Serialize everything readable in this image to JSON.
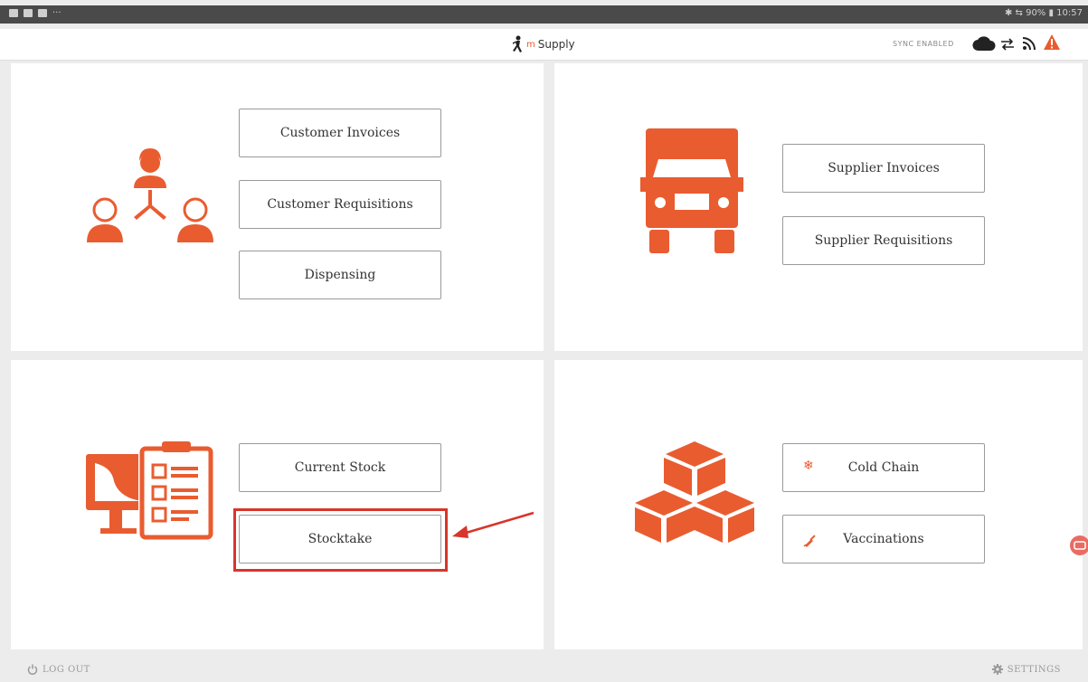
{
  "status_bar": {
    "right_text": "✱ ⇆ 90% ▮ 10:57"
  },
  "header": {
    "app_name_prefix": "m",
    "app_name": "Supply",
    "sync_label": "SYNC ENABLED"
  },
  "panels": {
    "customer": {
      "buttons": [
        "Customer Invoices",
        "Customer Requisitions",
        "Dispensing"
      ]
    },
    "supplier": {
      "buttons": [
        "Supplier Invoices",
        "Supplier Requisitions"
      ]
    },
    "stock": {
      "buttons": [
        "Current Stock",
        "Stocktake"
      ]
    },
    "modules": {
      "buttons": [
        "Cold Chain",
        "Vaccinations"
      ]
    }
  },
  "footer": {
    "logout_label": "LOG OUT",
    "settings_label": "SETTINGS"
  },
  "colors": {
    "brand": "#e95c30",
    "highlight": "#d8352b",
    "background": "#ececec"
  },
  "icons": [
    "people-icon",
    "truck-icon",
    "stock-icon",
    "boxes-icon",
    "snowflake-icon",
    "syringe-icon",
    "cloud-icon",
    "sync-icon",
    "rss-icon",
    "warning-icon",
    "power-icon",
    "gear-icon"
  ]
}
